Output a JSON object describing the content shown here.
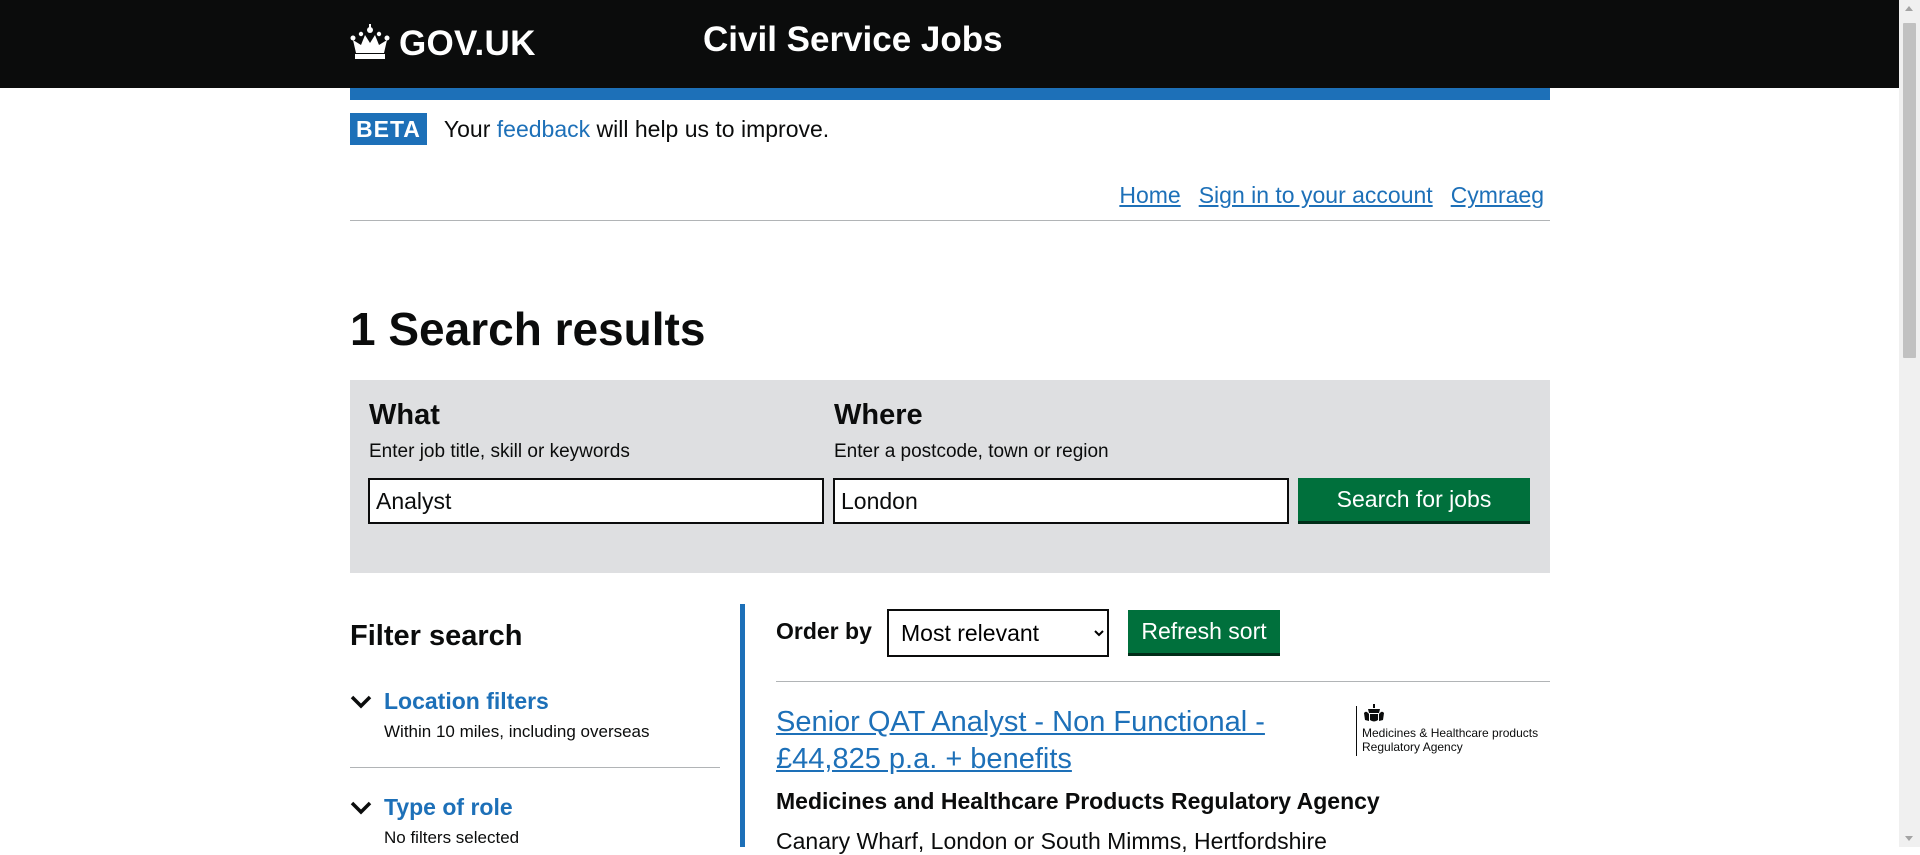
{
  "header": {
    "logo_text": "GOV.UK",
    "service_name": "Civil Service Jobs"
  },
  "phase_banner": {
    "tag": "BETA",
    "text_before": "Your ",
    "link": "feedback",
    "text_after": " will help us to improve."
  },
  "nav": {
    "links": [
      "Home",
      "Sign in to your account",
      "Cymraeg"
    ]
  },
  "page_title": "1 Search results",
  "search": {
    "what_label": "What",
    "what_hint": "Enter job title, skill or keywords",
    "what_value": "Analyst",
    "where_label": "Where",
    "where_hint": "Enter a postcode, town or region",
    "where_value": "London",
    "button": "Search for jobs"
  },
  "filters": {
    "title": "Filter search",
    "items": [
      {
        "label": "Location filters",
        "summary": "Within 10 miles, including overseas"
      },
      {
        "label": "Type of role",
        "summary": "No filters selected"
      }
    ]
  },
  "results": {
    "order_label": "Order by",
    "order_value": "Most relevant",
    "refresh_button": "Refresh sort",
    "jobs": [
      {
        "title": "Senior QAT Analyst - Non Functional - £44,825 p.a. + benefits",
        "department": "Medicines and Healthcare Products Regulatory Agency",
        "location": "Canary Wharf, London or South Mimms, Hertfordshire",
        "logo_text_line1": "Medicines & Healthcare products",
        "logo_text_line2": "Regulatory Agency"
      }
    ]
  },
  "colors": {
    "header_bg": "#0b0c0c",
    "link_blue": "#1d70b8",
    "button_green": "#00703c",
    "panel_grey": "#dedfe1"
  }
}
